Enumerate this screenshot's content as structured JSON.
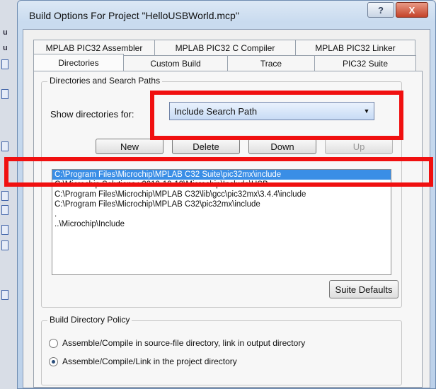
{
  "window": {
    "title": "Build Options For Project \"HelloUSBWorld.mcp\"",
    "help_label": "?",
    "close_label": "X"
  },
  "tabs_back": [
    "MPLAB PIC32 Assembler",
    "MPLAB PIC32 C Compiler",
    "MPLAB PIC32 Linker"
  ],
  "tabs_front": [
    "Directories",
    "Custom Build",
    "Trace",
    "PIC32 Suite"
  ],
  "directories": {
    "group_label": "Directories and Search Paths",
    "show_label": "Show directories for:",
    "selected_type": "Include Search Path",
    "buttons": {
      "new": "New",
      "delete": "Delete",
      "down": "Down",
      "up": "Up"
    },
    "paths": [
      "C:\\Program Files\\Microchip\\MPLAB C32 Suite\\pic32mx\\include",
      "C:\\Microchip Solutions v2010-10-19\\Microchip\\Include\\USB",
      "C:\\Program Files\\Microchip\\MPLAB C32\\lib\\gcc\\pic32mx\\3.4.4\\include",
      "C:\\Program Files\\Microchip\\MPLAB C32\\pic32mx\\include",
      ".",
      "..\\Microchip\\Include"
    ],
    "selected_index": 0,
    "suite_defaults": "Suite Defaults"
  },
  "build_policy": {
    "group_label": "Build Directory Policy",
    "options": [
      {
        "label": "Assemble/Compile in source-file directory, link in output directory",
        "checked": false
      },
      {
        "label": "Assemble/Compile/Link in the project directory",
        "checked": true
      }
    ]
  },
  "annotation_color": "#f01010"
}
